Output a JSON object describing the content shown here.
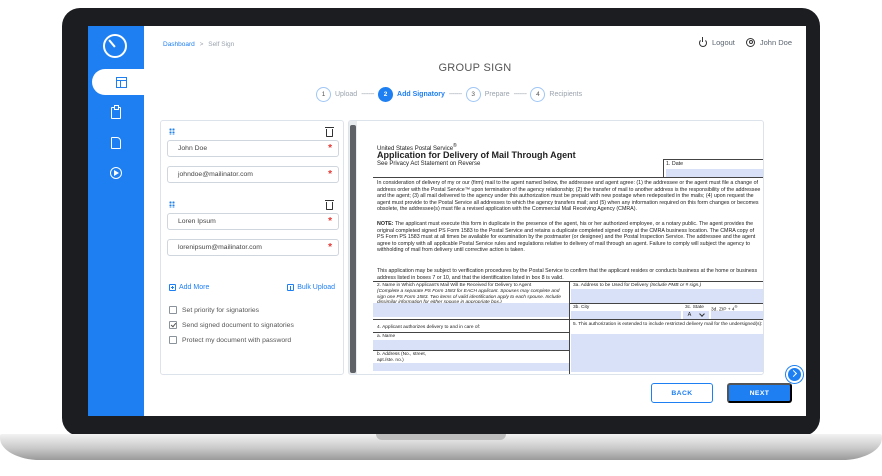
{
  "header": {
    "breadcrumb_root": "Dashboard",
    "breadcrumb_sep": ">",
    "breadcrumb_current": "Self Sign",
    "logout_label": "Logout",
    "user_name": "John Doe"
  },
  "page_title": "GROUP SIGN",
  "stepper": {
    "dashes": "-------",
    "steps": [
      {
        "num": "1",
        "label": "Upload"
      },
      {
        "num": "2",
        "label": "Add Signatory"
      },
      {
        "num": "3",
        "label": "Prepare"
      },
      {
        "num": "4",
        "label": "Recipients"
      }
    ]
  },
  "signatories": [
    {
      "name": "John Doe",
      "email": "johndoe@mailinator.com"
    },
    {
      "name": "Loren Ipsum",
      "email": "lorenipsum@mailinator.com"
    }
  ],
  "required_mark": "*",
  "actions": {
    "add_more": "Add More",
    "bulk_upload": "Bulk Upload"
  },
  "options": [
    {
      "label": "Set priority for signatories",
      "checked": false
    },
    {
      "label": "Send signed document to signatories",
      "checked": true
    },
    {
      "label": "Protect my document with password",
      "checked": false
    }
  ],
  "document": {
    "agency": "United States Postal Service",
    "reg_mark": "®",
    "title": "Application for Delivery of Mail Through Agent",
    "subtitle": "See Privacy Act Statement on Reverse",
    "date_label": "1. Date",
    "para1": "In consideration of delivery of my or our (firm) mail to the agent named below, the addressee and agent agree: (1) the addressee or the agent must file a change of address order with the Postal Service™ upon termination of the agency relationship; (2) the transfer of mail to another address is the responsibility of the addressee and the agent; (3) all mail delivered to the agency under this authorization must be prepaid with new postage when redeposited in the mails; (4) upon request the agent must provide to the Postal Service all addresses to which the agency transfers mail; and (5) when any information required on this form changes or becomes obsolete, the addressee(s) must file a revised application with the Commercial Mail Receiving Agency (CMRA).",
    "note_label": "NOTE:",
    "note_text": " The applicant must execute this form in duplicate in the presence of the agent, his or her authorized employee, or a notary public. The agent provides the original completed signed PS Form 1583 to the Postal Service and retains a duplicate completed signed copy at the CMRA business location. The CMRA copy of PS Form PS 1583 must at all times be available for examination by the postmaster (or designee) and the Postal Inspection Service. The addressee and the agent agree to comply with all applicable Postal Service rules and regulations relative to delivery of mail through an agent. Failure to comply will subject the agency to withholding of mail from delivery until corrective action is taken.",
    "para3": "This application may be subject to verification procedures by the Postal Service to confirm that the applicant resides or conducts business at the home or business address listed in boxes 7 or 10, and that the identification listed in box 8 is valid.",
    "box2_label": "2. Name in Which Applicant's Mail Will Be Received for Delivery to Agent",
    "box2_note": "(Complete a separate PS Form 1583 for EACH applicant. Spouses may complete and sign one PS Form 1583. Two items of valid identification apply to each spouse. Include dissimilar information for either spouse in appropriate box.)",
    "box3a_label": "3a. Address to be Used for Delivery",
    "box3a_note": "(Include PMB or # sign.)",
    "box3b_label": "3b. City",
    "box3c_label": "3c. State",
    "box3d_label": "3d. ZIP + 4",
    "box3d_sup": "®",
    "state_value": "A",
    "box4_label": "4. Applicant authorizes delivery to and in care of:",
    "box4a_label": "a. Name",
    "box4b_label": "b. Address (No., street, apt./ste. no.)",
    "box5_label": "5. This authorization is extended to include restricted delivery mail for the undersigned(s):"
  },
  "buttons": {
    "back": "BACK",
    "next": "NEXT"
  },
  "colors": {
    "accent": "#1d7ff2",
    "required": "#e53935",
    "form_fill": "#d8e1f7"
  },
  "icons": [
    "logo-icon",
    "template-icon",
    "clipboard-icon",
    "document-icon",
    "play-circle-icon",
    "logout-icon",
    "user-icon",
    "drag-handle-icon",
    "trash-icon",
    "add-icon",
    "upload-icon",
    "chevron-down-icon",
    "chat-icon"
  ]
}
